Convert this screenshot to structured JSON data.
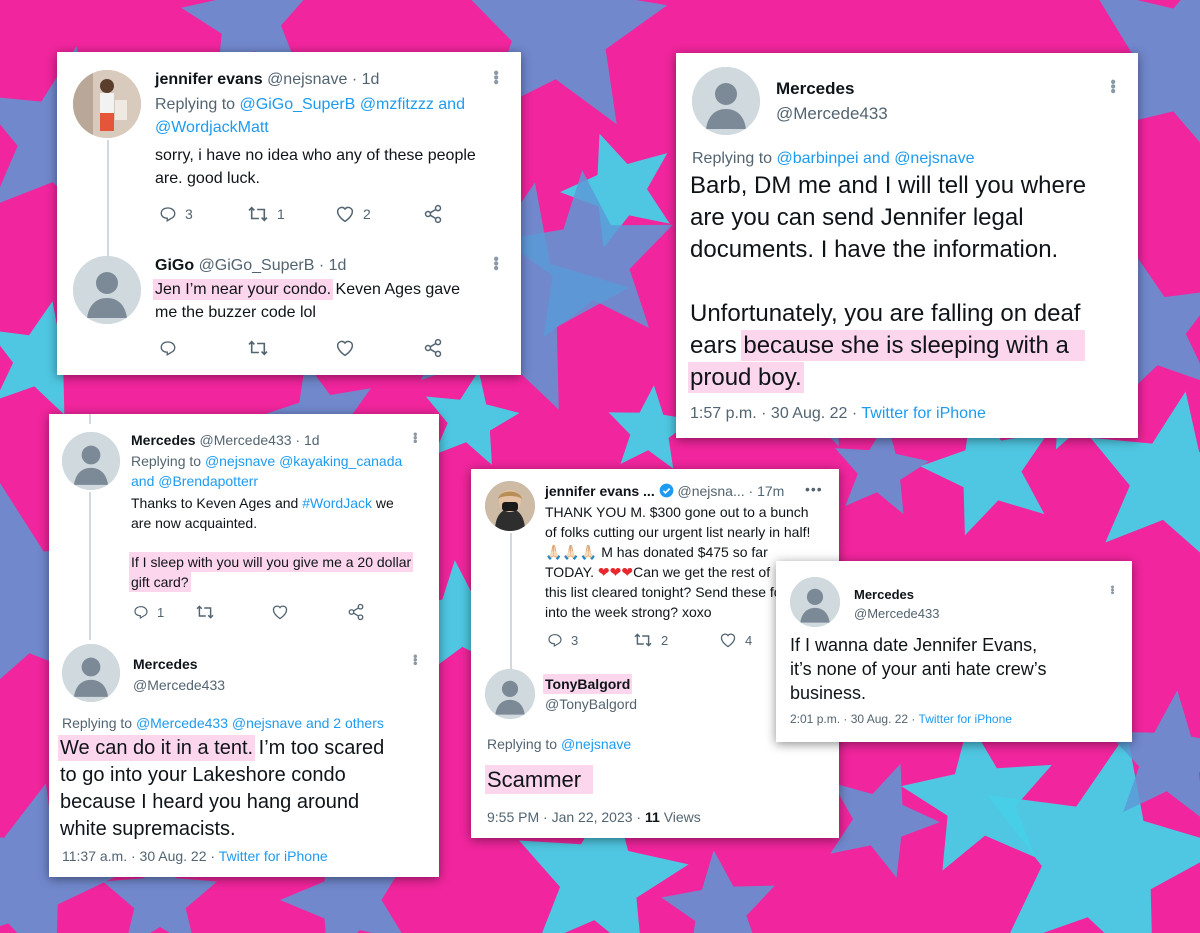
{
  "colors": {
    "background": "#f1259d",
    "star_blue": "#5b9ad6",
    "star_cyan": "#46d0e6",
    "link": "#1d9bf0",
    "highlight": "#fcd6ec"
  },
  "card1": {
    "tweet1": {
      "name": "jennifer evans",
      "handle": "@nejsnave",
      "time": "· 1d",
      "replying_to": "Replying to",
      "mention1": "@GiGo_SuperB",
      "mention2": "@mzfitzzz",
      "and": "and",
      "mention3": "@WordjackMatt",
      "text_line1": "sorry, i have no idea who any of these people",
      "text_line2": "are. good luck.",
      "replies": "3",
      "retweets": "1",
      "likes": "2"
    },
    "tweet2": {
      "name": "GiGo",
      "handle": "@GiGo_SuperB",
      "time": "· 1d",
      "highlight": "Jen I’m near your condo.",
      "text_rest": " Keven Ages gave",
      "text_line2": "me the buzzer code lol"
    }
  },
  "card2": {
    "name": "Mercedes",
    "handle": "@Mercede433",
    "replying_to": "Replying to",
    "mention1": "@barbinpei",
    "and": "and",
    "mention2": "@nejsnave",
    "para1_line1": "Barb, DM me and I will tell you where",
    "para1_line2": "are you can send Jennifer legal",
    "para1_line3": "documents. I have the information.",
    "para2_line1": "Unfortunately, you are falling on deaf",
    "para2_line2_start": "ears",
    "para2_highlight1": "because she is sleeping with a",
    "para2_highlight2": "proud boy.",
    "timestamp": "1:57 p.m. · 30 Aug. 22 ·",
    "source": "Twitter for iPhone"
  },
  "card3": {
    "tweet1": {
      "name": "Mercedes",
      "handle": "@Mercede433",
      "time": "· 1d",
      "replying_to": "Replying to",
      "mention1": "@nejsnave",
      "mention2": "@kayaking_canada",
      "and": "and",
      "mention3": "@Brendapotterr",
      "text1_start": "Thanks to Keven Ages and",
      "hashtag": "#WordJack",
      "text1_end": "we",
      "text1_line2": "are now acquainted.",
      "highlight_line1": "If I sleep with you will you give me a 20 dollar",
      "highlight_line2": "gift card?",
      "replies": "1"
    },
    "tweet2": {
      "name": "Mercedes",
      "handle": "@Mercede433",
      "replying_to": "Replying to",
      "mention1": "@Mercede433",
      "mention2": "@nejsnave",
      "others": "and 2 others",
      "highlight": "We can do it in a tent.",
      "text_rest": " I’m too scared",
      "line2": "to go into your Lakeshore condo",
      "line3": "because I heard you hang around",
      "line4": "white supremacists.",
      "timestamp": "11:37 a.m. · 30 Aug. 22 ·",
      "source": "Twitter for iPhone"
    }
  },
  "card4": {
    "tweet1": {
      "name": "jennifer evans ...",
      "handle": "@nejsna...",
      "time": "· 17m",
      "line1": "THANK YOU M. $300 gone out to a bunch",
      "line2": "of folks cutting our urgent list nearly in half!",
      "clap_emoji": "🙏🏻🙏🏻🙏🏻",
      "line3": "M has donated $475 so far",
      "line4_start": "TODAY.",
      "hearts": "❤❤❤",
      "line4_end": "Can we get the rest of",
      "line5": "this list cleared tonight? Send these folks",
      "line6": "into the week strong? xoxo",
      "replies": "3",
      "retweets": "2",
      "likes": "4"
    },
    "tweet2": {
      "name": "TonyBalgord",
      "handle": "@TonyBalgord",
      "replying_to": "Replying to",
      "mention": "@nejsnave",
      "text": "Scammer",
      "timestamp": "9:55 PM · Jan 22, 2023 ·",
      "views_count": "11",
      "views_label": "Views"
    }
  },
  "card5": {
    "name": "Mercedes",
    "handle": "@Mercede433",
    "line1": "If I wanna date Jennifer Evans,",
    "line2": "it’s none of your anti hate crew’s",
    "line3": "business.",
    "timestamp": "2:01 p.m. · 30 Aug. 22 ·",
    "source": "Twitter for iPhone"
  },
  "icons": [
    "reply-icon",
    "retweet-icon",
    "like-icon",
    "share-icon",
    "more-icon",
    "verified-icon",
    "default-avatar-icon"
  ]
}
